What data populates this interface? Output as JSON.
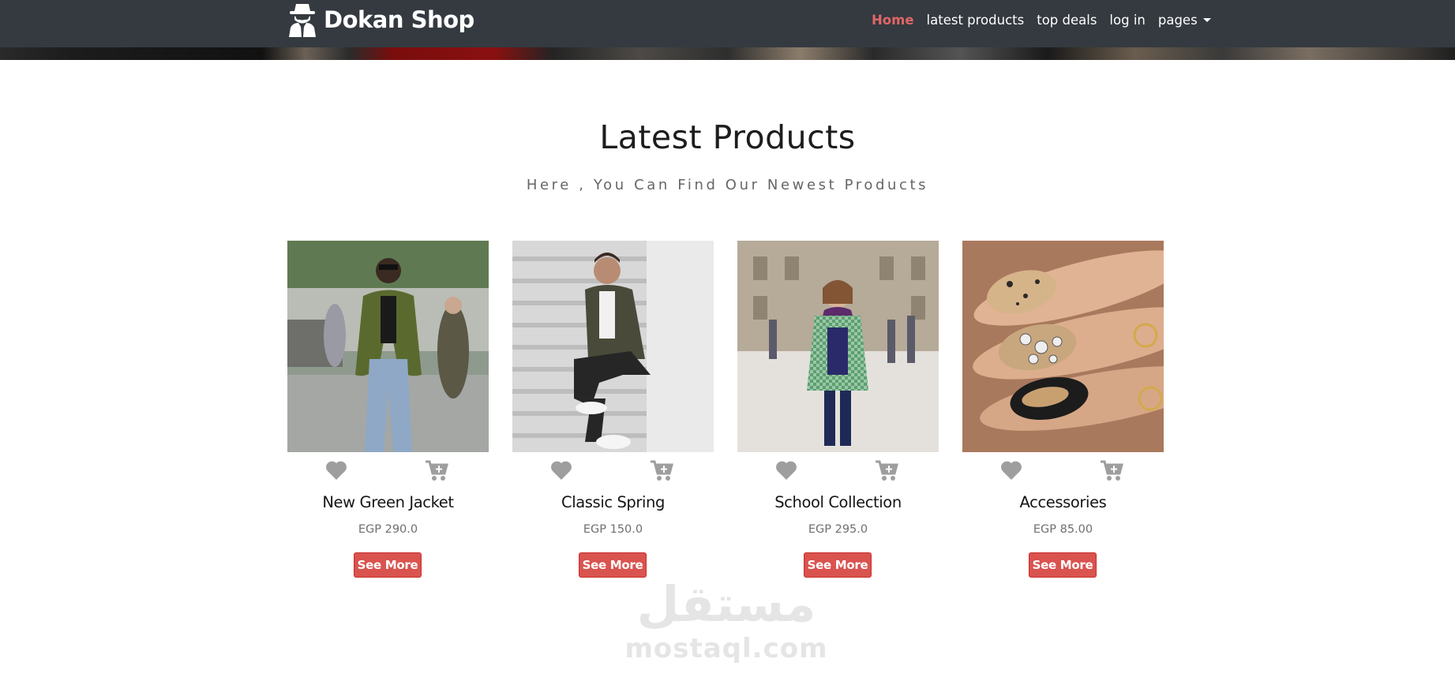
{
  "brand": {
    "name": "Dokan Shop",
    "logo_icon": "spy-logo-icon"
  },
  "nav": {
    "items": [
      {
        "label": "Home",
        "active": true
      },
      {
        "label": "latest products"
      },
      {
        "label": "top deals"
      },
      {
        "label": "log in"
      },
      {
        "label": "pages",
        "dropdown": true
      }
    ]
  },
  "section": {
    "title": "Latest Products",
    "subtitle": "Here , You Can Find Our Newest Products"
  },
  "products": [
    {
      "title": "New Green Jacket",
      "price": "EGP 290.0",
      "button": "See More",
      "wishlist_icon": "heart-icon",
      "cart_icon": "cart-plus-icon"
    },
    {
      "title": "Classic Spring",
      "price": "EGP 150.0",
      "button": "See More",
      "wishlist_icon": "heart-icon",
      "cart_icon": "cart-plus-icon"
    },
    {
      "title": "School Collection",
      "price": "EGP 295.0",
      "button": "See More",
      "wishlist_icon": "heart-icon",
      "cart_icon": "cart-plus-icon"
    },
    {
      "title": "Accessories",
      "price": "EGP 85.00",
      "button": "See More",
      "wishlist_icon": "heart-icon",
      "cart_icon": "cart-plus-icon"
    }
  ],
  "watermark": {
    "arabic": "مستقل",
    "latin": "mostaql.com"
  },
  "colors": {
    "navbar": "#343a40",
    "accent": "#d9534f",
    "active_link": "#e06666",
    "icon_gray": "#9e9e9e"
  }
}
